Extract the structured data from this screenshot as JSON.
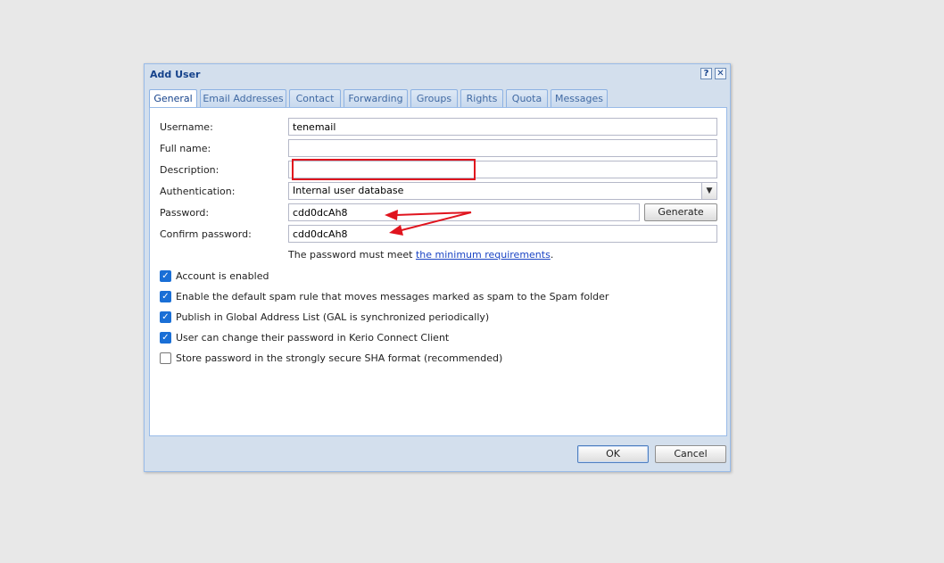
{
  "dialog": {
    "title": "Add User",
    "help_symbol": "?",
    "close_symbol": "✕"
  },
  "tabs": [
    {
      "label": "General"
    },
    {
      "label": "Email Addresses"
    },
    {
      "label": "Contact"
    },
    {
      "label": "Forwarding"
    },
    {
      "label": "Groups"
    },
    {
      "label": "Rights"
    },
    {
      "label": "Quota"
    },
    {
      "label": "Messages"
    }
  ],
  "form": {
    "username_label": "Username:",
    "username_value": "tenemail",
    "fullname_label": "Full name:",
    "fullname_value": "",
    "description_label": "Description:",
    "description_value": "",
    "authentication_label": "Authentication:",
    "authentication_value": "Internal user database",
    "password_label": "Password:",
    "password_value": "cdd0dcAh8",
    "generate_label": "Generate",
    "confirm_label": "Confirm password:",
    "confirm_value": "cdd0dcAh8",
    "note_prefix": "The password must meet ",
    "note_link": "the minimum requirements",
    "note_suffix": "."
  },
  "checkboxes": [
    {
      "label": "Account is enabled",
      "checked": true
    },
    {
      "label": "Enable the default spam rule that moves messages marked as spam to the Spam folder",
      "checked": true
    },
    {
      "label": "Publish in Global Address List (GAL is synchronized periodically)",
      "checked": true
    },
    {
      "label": "User can change their password in Kerio Connect Client",
      "checked": true
    },
    {
      "label": "Store password in the strongly secure SHA format (recommended)",
      "checked": false
    }
  ],
  "footer": {
    "ok_label": "OK",
    "cancel_label": "Cancel"
  },
  "icons": {
    "check": "✓",
    "combo_arrow": "▼"
  },
  "colors": {
    "annotation_red": "#e0141e",
    "title_blue": "#15428b",
    "checkbox_blue": "#1a6fd6"
  }
}
